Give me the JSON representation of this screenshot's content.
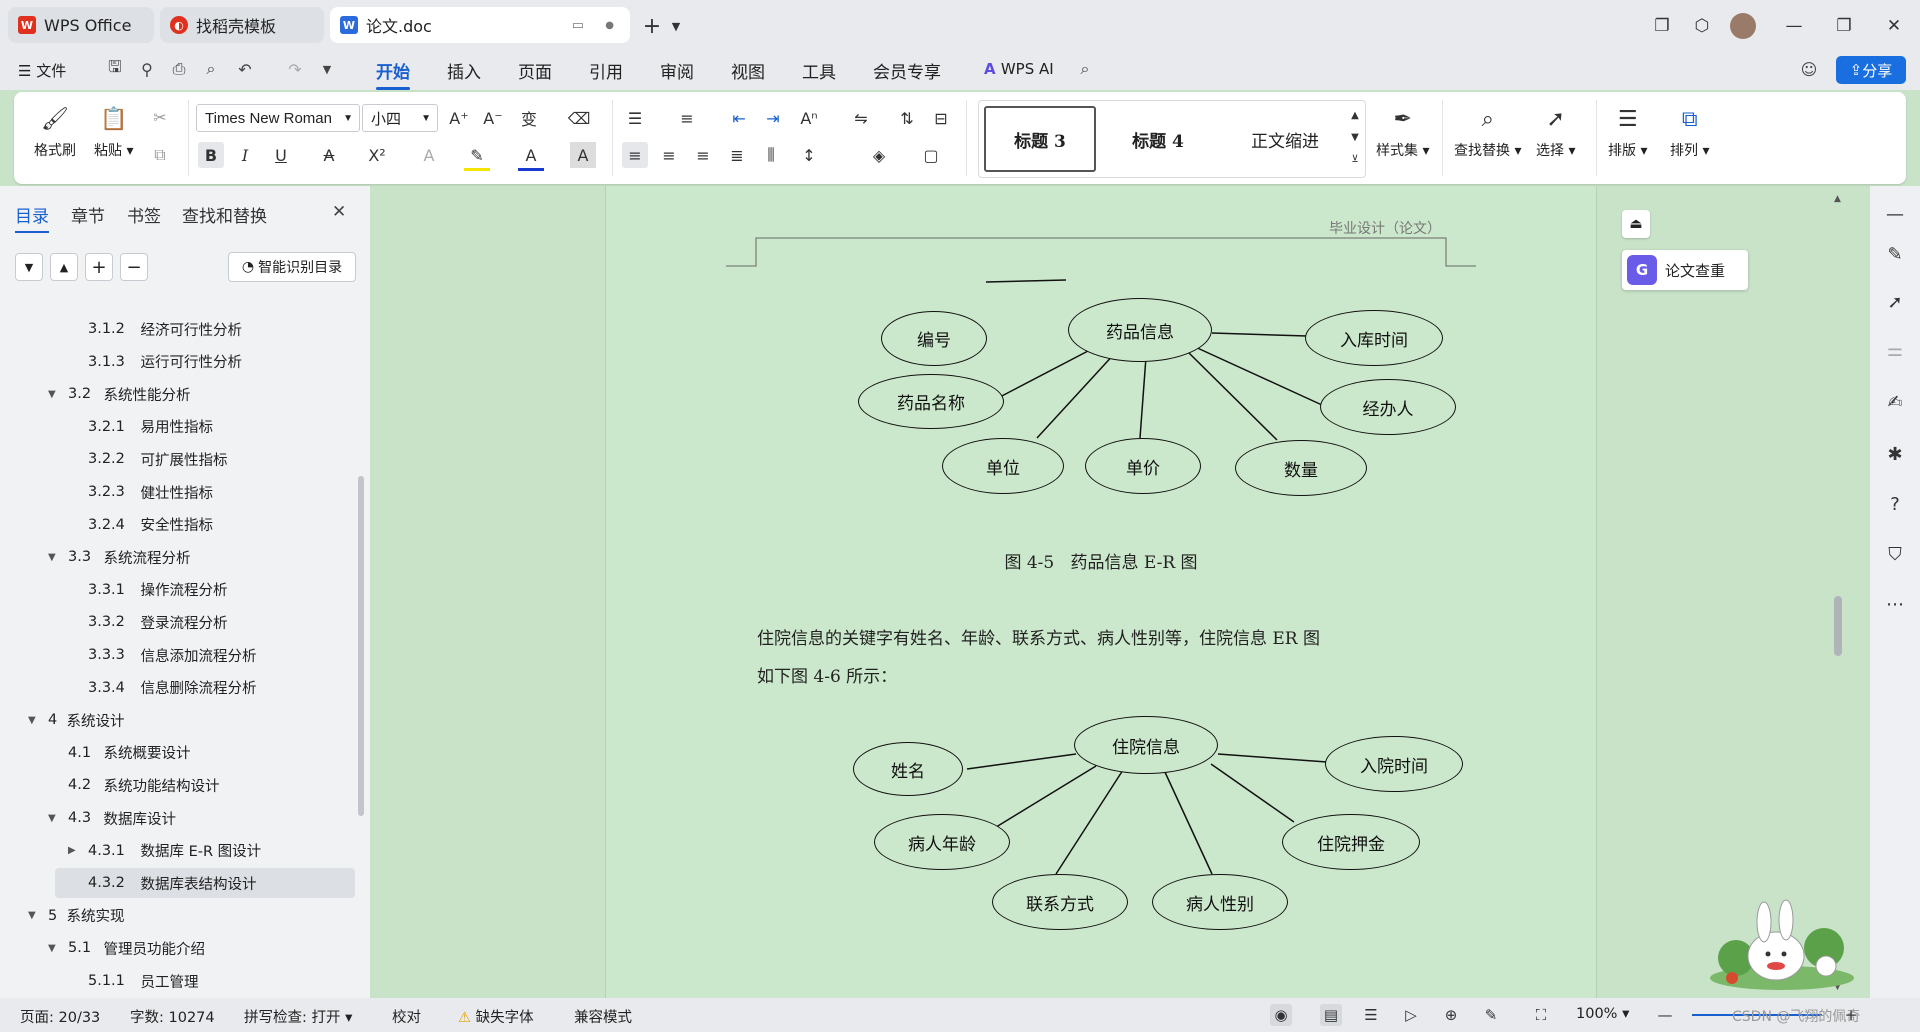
{
  "tabs": [
    {
      "label": "WPS Office"
    },
    {
      "label": "找稻壳模板"
    },
    {
      "label": "论文.doc"
    }
  ],
  "menu": {
    "file": "文件",
    "items": [
      "开始",
      "插入",
      "页面",
      "引用",
      "审阅",
      "视图",
      "工具",
      "会员专享"
    ],
    "wps_ai": "WPS AI",
    "share": "分享"
  },
  "ribbon": {
    "format_painter": "格式刷",
    "paste": "粘贴",
    "font_name": "Times New Roman",
    "font_size": "小四",
    "styles": [
      "标题 3",
      "标题 4",
      "正文缩进"
    ],
    "style_set": "样式集",
    "find_replace": "查找替换",
    "select": "选择",
    "layout": "排版",
    "arrange": "排列"
  },
  "panel": {
    "tabs": [
      "目录",
      "章节",
      "书签",
      "查找和替换"
    ],
    "smart_toc": "智能识别目录",
    "toc": [
      {
        "num": "3.1.2",
        "text": "经济可行性分析",
        "level": 3,
        "arrow": ""
      },
      {
        "num": "3.1.3",
        "text": "运行可行性分析",
        "level": 3,
        "arrow": ""
      },
      {
        "num": "3.2",
        "text": "系统性能分析",
        "level": 2,
        "arrow": "▼"
      },
      {
        "num": "3.2.1",
        "text": "易用性指标",
        "level": 3,
        "arrow": ""
      },
      {
        "num": "3.2.2",
        "text": "可扩展性指标",
        "level": 3,
        "arrow": ""
      },
      {
        "num": "3.2.3",
        "text": "健壮性指标",
        "level": 3,
        "arrow": ""
      },
      {
        "num": "3.2.4",
        "text": "安全性指标",
        "level": 3,
        "arrow": ""
      },
      {
        "num": "3.3",
        "text": "系统流程分析",
        "level": 2,
        "arrow": "▼"
      },
      {
        "num": "3.3.1",
        "text": "操作流程分析",
        "level": 3,
        "arrow": ""
      },
      {
        "num": "3.3.2",
        "text": "登录流程分析",
        "level": 3,
        "arrow": ""
      },
      {
        "num": "3.3.3",
        "text": "信息添加流程分析",
        "level": 3,
        "arrow": ""
      },
      {
        "num": "3.3.4",
        "text": "信息删除流程分析",
        "level": 3,
        "arrow": ""
      },
      {
        "num": "4",
        "text": "系统设计",
        "level": 1,
        "arrow": "▼"
      },
      {
        "num": "4.1",
        "text": "系统概要设计",
        "level": 2,
        "arrow": ""
      },
      {
        "num": "4.2",
        "text": "系统功能结构设计",
        "level": 2,
        "arrow": ""
      },
      {
        "num": "4.3",
        "text": "数据库设计",
        "level": 2,
        "arrow": "▼"
      },
      {
        "num": "4.3.1",
        "text": "数据库 E-R 图设计",
        "level": 3,
        "arrow": "▶"
      },
      {
        "num": "4.3.2",
        "text": "数据库表结构设计",
        "level": 3,
        "arrow": "",
        "selected": true
      },
      {
        "num": "5",
        "text": "系统实现",
        "level": 1,
        "arrow": "▼"
      },
      {
        "num": "5.1",
        "text": "管理员功能介绍",
        "level": 2,
        "arrow": "▼"
      },
      {
        "num": "5.1.1",
        "text": "员工管理",
        "level": 3,
        "arrow": ""
      }
    ]
  },
  "doc": {
    "header": "毕业设计（论文）",
    "er1": {
      "center": "药品信息",
      "attrs": [
        "编号",
        "药品名称",
        "单位",
        "单价",
        "数量",
        "经办人",
        "入库时间"
      ]
    },
    "caption1": "图 4-5   药品信息 E-R 图",
    "para_line1": "住院信息的关键字有姓名、年龄、联系方式、病人性别等，住院信息 ER 图",
    "para_line2": "如下图 4-6 所示：",
    "er2": {
      "center": "住院信息",
      "attrs": [
        "姓名",
        "病人年龄",
        "联系方式",
        "病人性别",
        "住院押金",
        "入院时间"
      ]
    }
  },
  "float": {
    "check": "论文查重"
  },
  "status": {
    "page": "页面: 20/33",
    "words": "字数: 10274",
    "spell": "拼写检查: 打开",
    "proof": "校对",
    "missing_font": "缺失字体",
    "compat": "兼容模式",
    "zoom": "100%",
    "watermark": "CSDN @飞翔的佩奇"
  }
}
